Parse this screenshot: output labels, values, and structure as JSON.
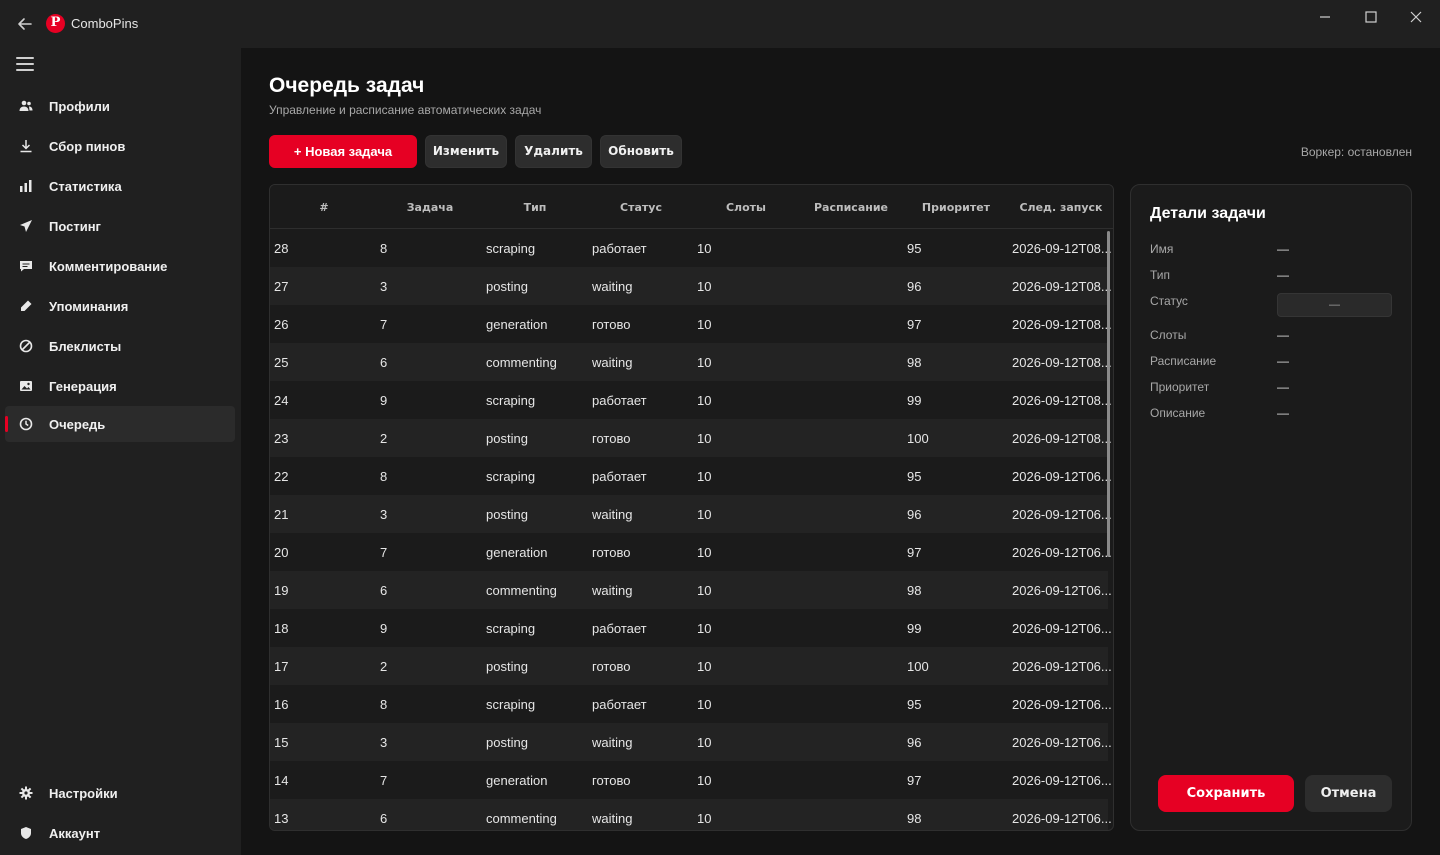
{
  "window": {
    "title": "ComboPins",
    "minimize_icon": "minimize-icon",
    "maximize_icon": "maximize-icon",
    "close_icon": "close-icon"
  },
  "sidebar": {
    "items": [
      {
        "label": "Профили",
        "icon": "users-icon"
      },
      {
        "label": "Сбор пинов",
        "icon": "download-icon"
      },
      {
        "label": "Статистика",
        "icon": "bar-chart-icon"
      },
      {
        "label": "Постинг",
        "icon": "send-icon"
      },
      {
        "label": "Комментирование",
        "icon": "comment-icon"
      },
      {
        "label": "Упоминания",
        "icon": "pen-icon"
      },
      {
        "label": "Блеклисты",
        "icon": "block-icon"
      },
      {
        "label": "Генерация",
        "icon": "image-icon"
      },
      {
        "label": "Очередь",
        "icon": "clock-icon",
        "active": true
      }
    ],
    "bottom": [
      {
        "label": "Настройки",
        "icon": "gear-icon"
      },
      {
        "label": "Аккаунт",
        "icon": "shield-icon"
      }
    ]
  },
  "header": {
    "title": "Очередь задач",
    "subtitle": "Управление и расписание автоматических задач"
  },
  "toolbar": {
    "new_task": "+ Новая задача",
    "edit": "Изменить",
    "delete": "Удалить",
    "refresh": "Обновить",
    "worker_status": "Воркер: остановлен"
  },
  "table": {
    "columns": [
      "#",
      "Задача",
      "Тип",
      "Статус",
      "Слоты",
      "Расписание",
      "Приоритет",
      "След. запуск"
    ],
    "rows": [
      [
        "28",
        "8",
        "scraping",
        "работает",
        "10",
        "",
        "95",
        "2026-09-12T08..."
      ],
      [
        "27",
        "3",
        "posting",
        "waiting",
        "10",
        "",
        "96",
        "2026-09-12T08..."
      ],
      [
        "26",
        "7",
        "generation",
        "готово",
        "10",
        "",
        "97",
        "2026-09-12T08..."
      ],
      [
        "25",
        "6",
        "commenting",
        "waiting",
        "10",
        "",
        "98",
        "2026-09-12T08..."
      ],
      [
        "24",
        "9",
        "scraping",
        "работает",
        "10",
        "",
        "99",
        "2026-09-12T08..."
      ],
      [
        "23",
        "2",
        "posting",
        "готово",
        "10",
        "",
        "100",
        "2026-09-12T08..."
      ],
      [
        "22",
        "8",
        "scraping",
        "работает",
        "10",
        "",
        "95",
        "2026-09-12T06..."
      ],
      [
        "21",
        "3",
        "posting",
        "waiting",
        "10",
        "",
        "96",
        "2026-09-12T06..."
      ],
      [
        "20",
        "7",
        "generation",
        "готово",
        "10",
        "",
        "97",
        "2026-09-12T06..."
      ],
      [
        "19",
        "6",
        "commenting",
        "waiting",
        "10",
        "",
        "98",
        "2026-09-12T06..."
      ],
      [
        "18",
        "9",
        "scraping",
        "работает",
        "10",
        "",
        "99",
        "2026-09-12T06..."
      ],
      [
        "17",
        "2",
        "posting",
        "готово",
        "10",
        "",
        "100",
        "2026-09-12T06..."
      ],
      [
        "16",
        "8",
        "scraping",
        "работает",
        "10",
        "",
        "95",
        "2026-09-12T06..."
      ],
      [
        "15",
        "3",
        "posting",
        "waiting",
        "10",
        "",
        "96",
        "2026-09-12T06..."
      ],
      [
        "14",
        "7",
        "generation",
        "готово",
        "10",
        "",
        "97",
        "2026-09-12T06..."
      ],
      [
        "13",
        "6",
        "commenting",
        "waiting",
        "10",
        "",
        "98",
        "2026-09-12T06..."
      ]
    ]
  },
  "details": {
    "title": "Детали задачи",
    "fields": [
      {
        "label": "Имя",
        "value": "—"
      },
      {
        "label": "Тип",
        "value": "—"
      },
      {
        "label": "Статус",
        "value": "—"
      },
      {
        "label": "Слоты",
        "value": "—"
      },
      {
        "label": "Расписание",
        "value": "—"
      },
      {
        "label": "Приоритет",
        "value": "—"
      },
      {
        "label": "Описание",
        "value": "—"
      }
    ],
    "save": "Сохранить",
    "cancel": "Отмена"
  },
  "colors": {
    "accent": "#e60023",
    "background": "#141414",
    "sidebar": "#202020"
  }
}
